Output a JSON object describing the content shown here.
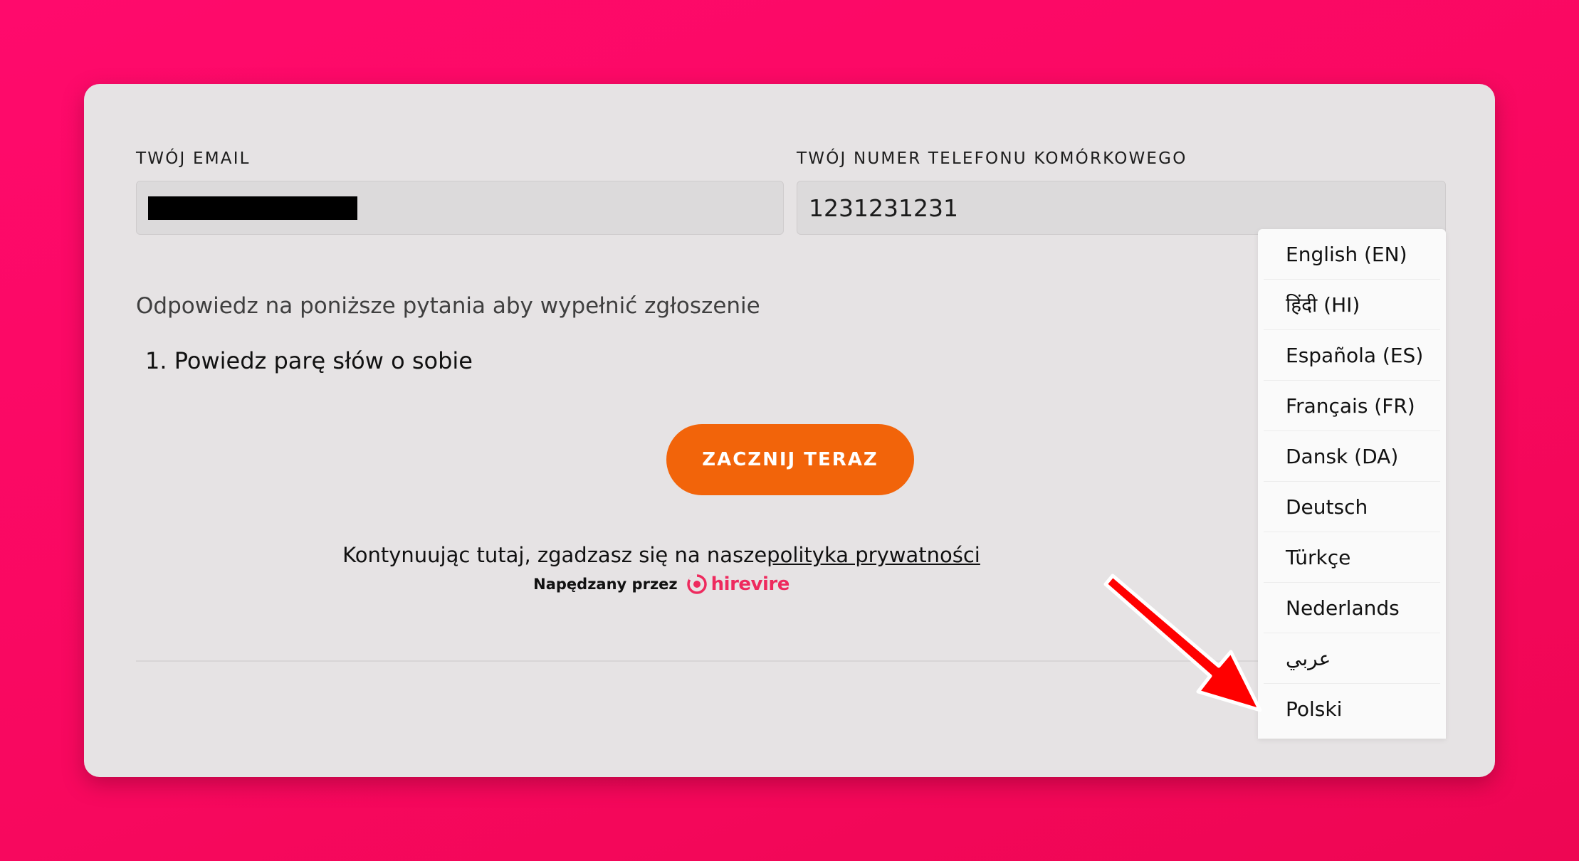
{
  "form": {
    "email_label": "TWÓJ EMAIL",
    "email_value": "",
    "phone_label": "TWÓJ NUMER TELEFONU KOMÓRKOWEGO",
    "phone_value": "1231231231"
  },
  "prompt": "Odpowiedz na poniższe pytania aby wypełnić zgłoszenie",
  "questions": [
    "1. Powiedz parę słów o sobie"
  ],
  "start_button_label": "ZACZNIJ TERAZ",
  "footer": {
    "consent_text": "Kontynuując tutaj, zgadzasz się na nasze",
    "privacy_link": "polityka prywatności",
    "powered_by": "Napędzany przez",
    "brand_name": "hirevire",
    "brand_color": "#ee2a5e"
  },
  "language_dropdown": {
    "options": [
      "English (EN)",
      "हिंदी (HI)",
      "Española (ES)",
      "Français (FR)",
      "Dansk (DA)",
      "Deutsch",
      "Türkçe",
      "Nederlands",
      "عربي",
      "Polski"
    ]
  },
  "colors": {
    "background": "#ff0a6c",
    "card": "#e6e3e4",
    "button": "#f2640a",
    "annotation_arrow": "#ff0000"
  }
}
